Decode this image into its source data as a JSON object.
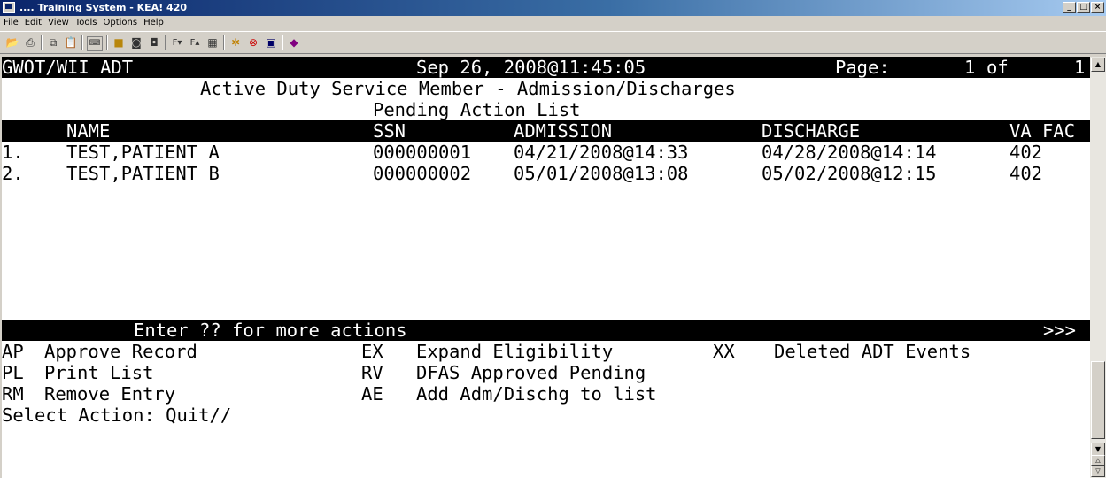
{
  "window": {
    "title": ".... Training System - KEA! 420",
    "controls": [
      "_",
      "□",
      "×"
    ]
  },
  "menu": [
    "File",
    "Edit",
    "View",
    "Tools",
    "Options",
    "Help"
  ],
  "toolbar_icons": [
    "open-icon",
    "print-icon",
    "copy-icon",
    "paste-icon",
    "keyboard-icon",
    "folder-icon",
    "camera-icon",
    "camera2-icon",
    "font-down-icon",
    "font-up-icon",
    "calculator-icon",
    "settings-icon",
    "stop-icon",
    "screen-icon",
    "book-icon"
  ],
  "terminal": {
    "header": {
      "system": "GWOT/WII ADT",
      "datetime": "Sep 26, 2008@11:45:05",
      "page_label": "Page:",
      "page_current": "1",
      "page_of": "of",
      "page_total": "1"
    },
    "title_line1": "Active Duty Service Member - Admission/Discharges",
    "title_line2": "Pending Action List",
    "columns": {
      "name": "NAME",
      "ssn": "SSN",
      "admission": "ADMISSION",
      "discharge": "DISCHARGE",
      "vafac": "VA FAC"
    },
    "rows": [
      {
        "num": "1.",
        "name": "TEST,PATIENT A",
        "ssn": "000000001",
        "admission": "04/21/2008@14:33",
        "discharge": "04/28/2008@14:14",
        "vafac": "402"
      },
      {
        "num": "2.",
        "name": "TEST,PATIENT B",
        "ssn": "000000002",
        "admission": "05/01/2008@13:08",
        "discharge": "05/02/2008@12:15",
        "vafac": "402"
      }
    ],
    "more_actions": "Enter ?? for more actions",
    "more_indicator": ">>>",
    "actions": [
      [
        {
          "code": "AP",
          "label": "Approve Record"
        },
        {
          "code": "EX",
          "label": "Expand Eligibility"
        },
        {
          "code": "XX",
          "label": "Deleted ADT Events"
        }
      ],
      [
        {
          "code": "PL",
          "label": "Print List"
        },
        {
          "code": "RV",
          "label": "DFAS Approved Pending"
        }
      ],
      [
        {
          "code": "RM",
          "label": "Remove Entry"
        },
        {
          "code": "AE",
          "label": "Add Adm/Dischg to list"
        }
      ]
    ],
    "prompt": "Select Action: Quit//"
  }
}
